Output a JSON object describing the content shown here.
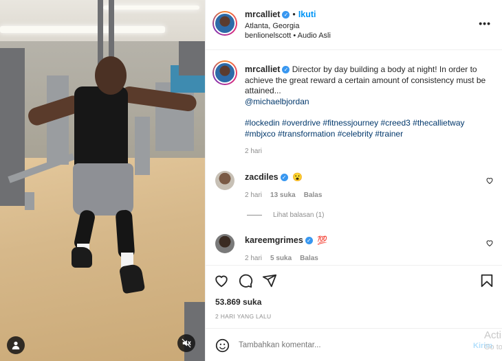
{
  "post": {
    "author": "mrcalliet",
    "follow_label": "Ikuti",
    "location": "Atlanta, Georgia",
    "audio": "benlionelscott • Audio Asli",
    "more_label": "•••"
  },
  "caption": {
    "author": "mrcalliet",
    "text": "Director by day building a body at night! In order to achieve the great reward a certain amount of consistency must be attained...",
    "mention": "@michaelbjordan",
    "hashtags_line1": "#lockedin #overdrive #fitnessjourney #creed3 #thecallietway",
    "hashtags_line2": "#mbjxco #transformation #celebrity #trainer",
    "time": "2 hari"
  },
  "comments": [
    {
      "user": "zacdiles",
      "verified": true,
      "emoji": "😮",
      "time": "2 hari",
      "likes": "13 suka",
      "reply": "Balas",
      "view_replies": "Lihat balasan (1)"
    },
    {
      "user": "kareemgrimes",
      "verified": true,
      "emoji": "💯",
      "time": "2 hari",
      "likes": "5 suka",
      "reply": "Balas"
    }
  ],
  "footer": {
    "likes": "53.869 suka",
    "ago": "2 HARI YANG LALU",
    "comment_placeholder": "Tambahkan komentar...",
    "post_label": "Kirim"
  },
  "overlay": {
    "activate_line1": "Acti",
    "activate_line2": "Go to"
  },
  "colors": {
    "link": "#00376b",
    "follow": "#0095f6",
    "verified": "#3897f0",
    "muted": "#8e8e8e"
  }
}
